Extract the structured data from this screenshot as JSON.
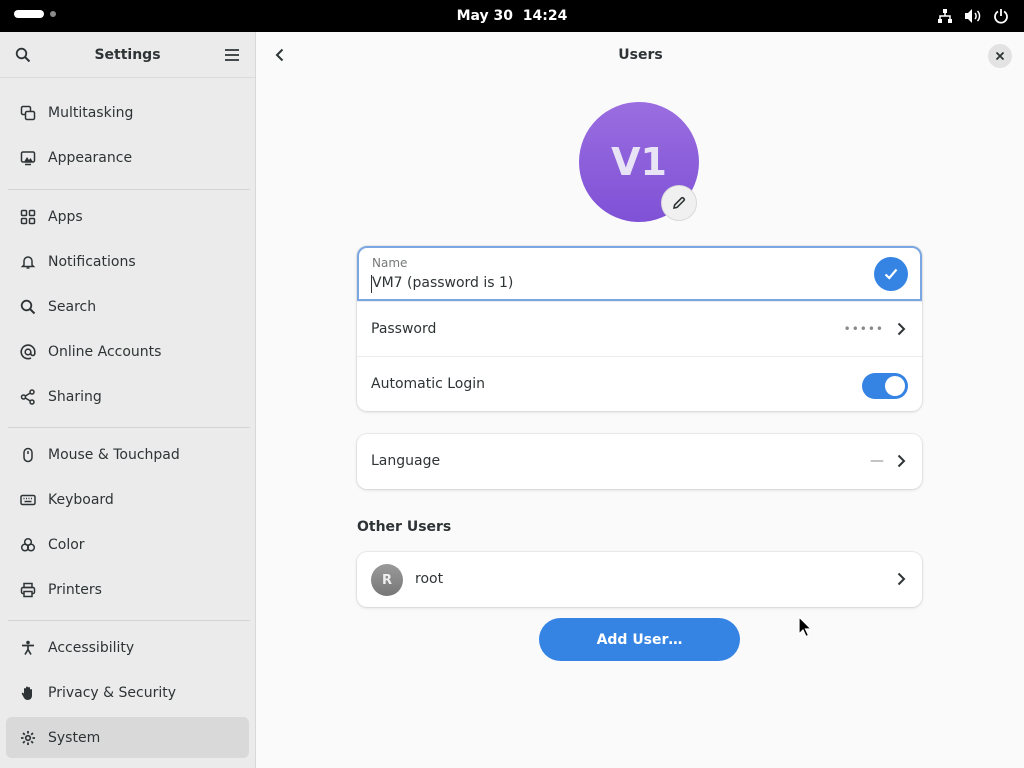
{
  "topbar": {
    "date": "May 30",
    "time": "14:24",
    "icons": [
      "network-icon",
      "volume-icon",
      "power-icon"
    ]
  },
  "sidebar": {
    "title": "Settings",
    "items": [
      {
        "label": "Multitasking",
        "icon": "multitasking-icon"
      },
      {
        "label": "Appearance",
        "icon": "appearance-icon"
      },
      {
        "label": "Apps",
        "icon": "apps-icon"
      },
      {
        "label": "Notifications",
        "icon": "bell-icon"
      },
      {
        "label": "Search",
        "icon": "search-icon"
      },
      {
        "label": "Online Accounts",
        "icon": "at-icon"
      },
      {
        "label": "Sharing",
        "icon": "share-icon"
      },
      {
        "label": "Mouse & Touchpad",
        "icon": "mouse-icon"
      },
      {
        "label": "Keyboard",
        "icon": "keyboard-icon"
      },
      {
        "label": "Color",
        "icon": "color-icon"
      },
      {
        "label": "Printers",
        "icon": "printer-icon"
      },
      {
        "label": "Accessibility",
        "icon": "accessibility-icon"
      },
      {
        "label": "Privacy & Security",
        "icon": "hand-icon"
      },
      {
        "label": "System",
        "icon": "gear-icon",
        "active": true
      }
    ]
  },
  "main": {
    "title": "Users",
    "avatar_initials": "V1",
    "name_caption": "Name",
    "name_value": "VM7 (password is 1)",
    "password_label": "Password",
    "password_mask": "•••••",
    "autologin_label": "Automatic Login",
    "autologin_enabled": true,
    "language_label": "Language",
    "language_value": "—",
    "other_users_title": "Other Users",
    "other_users": [
      {
        "initial": "R",
        "name": "root"
      }
    ],
    "add_user_label": "Add User…"
  },
  "colors": {
    "accent": "#3584e4",
    "avatar": "#8a5cdc",
    "sidebar_bg": "#ebebeb",
    "main_bg": "#fafafa"
  }
}
